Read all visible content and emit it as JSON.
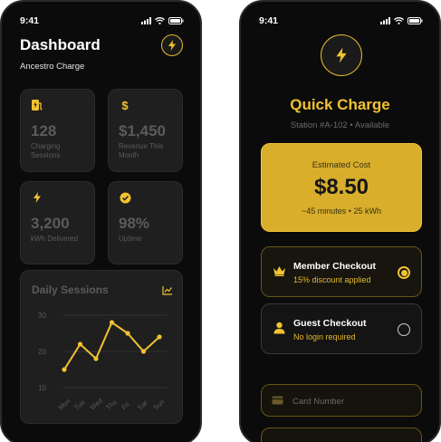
{
  "status_bar": {
    "time": "9:41"
  },
  "dashboard": {
    "title": "Dashboard",
    "subtitle": "Ancestro Charge",
    "stats": [
      {
        "icon": "ev-station-icon",
        "value": "128",
        "label": "Charging Sessions"
      },
      {
        "icon": "dollar-icon",
        "value": "$1,450",
        "label": "Revenue This Month"
      },
      {
        "icon": "bolt-icon",
        "value": "3,200",
        "label": "kWh Delivered"
      },
      {
        "icon": "check-circle-icon",
        "value": "98%",
        "label": "Uptime"
      }
    ],
    "chart_title": "Daily Sessions"
  },
  "chart_data": {
    "type": "line",
    "title": "Daily Sessions",
    "categories": [
      "Mon",
      "Tue",
      "Wed",
      "Thu",
      "Fri",
      "Sat",
      "Sun"
    ],
    "values": [
      15,
      22,
      18,
      28,
      25,
      20,
      24
    ],
    "yticks": [
      10,
      20,
      30
    ],
    "ylim": [
      10,
      30
    ],
    "grid": true,
    "line_color": "#f2c230"
  },
  "quick_charge": {
    "title": "Quick Charge",
    "station": "Station #A-102 • Available",
    "cost_label": "Estimated Cost",
    "cost_value": "$8.50",
    "cost_detail": "~45 minutes • 25 kWh",
    "member": {
      "title": "Member Checkout",
      "subtitle": "15% discount applied",
      "selected": true
    },
    "guest": {
      "title": "Guest Checkout",
      "subtitle": "No login required",
      "selected": false
    },
    "card_placeholder": "Card Number"
  },
  "colors": {
    "accent": "#f2c230",
    "background": "#0b0b0b",
    "card": "#1f1f1f"
  }
}
